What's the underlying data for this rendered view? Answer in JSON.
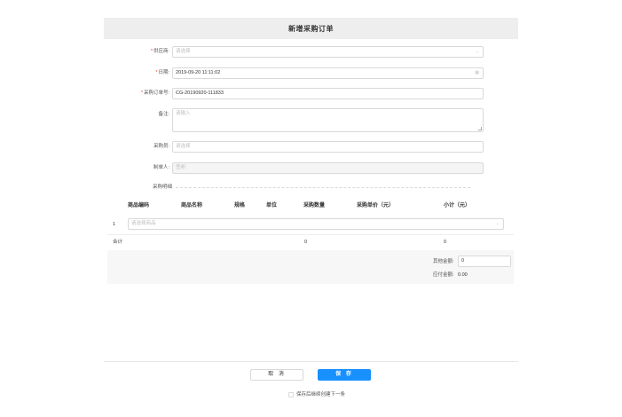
{
  "header": {
    "title": "新增采购订单"
  },
  "form": {
    "supplier": {
      "label": "供应商:",
      "placeholder": "请选择"
    },
    "date": {
      "label": "日期:",
      "value": "2019-09-20 11:11:02"
    },
    "order_no": {
      "label": "采购订单号:",
      "value": "CG-20190920-111833"
    },
    "remark": {
      "label": "备注:",
      "placeholder": "请输入"
    },
    "buyer": {
      "label": "采购员:",
      "placeholder": "请选择"
    },
    "creator": {
      "label": "制单人:",
      "value": "签邦"
    }
  },
  "detail": {
    "section_title": "采购明细",
    "columns": [
      "商品编码",
      "商品名称",
      "规格",
      "单位",
      "采购数量",
      "采购单价（元）",
      "小计（元）"
    ],
    "row": {
      "index": "1",
      "product_placeholder": "请选择商品"
    },
    "total": {
      "label": "合计",
      "qty": "0",
      "subtotal": "0"
    }
  },
  "summary": {
    "other_label": "其他金额:",
    "other_value": "0",
    "payable_label": "应付金额:",
    "payable_value": "0.00"
  },
  "footer": {
    "cancel_label": "取 消",
    "save_label": "保 存",
    "continue_label": "保存后继续创建下一条"
  },
  "icons": {
    "chevron": "⌄",
    "calendar": "▦"
  },
  "colors": {
    "primary": "#1890ff",
    "required": "#f04134"
  }
}
